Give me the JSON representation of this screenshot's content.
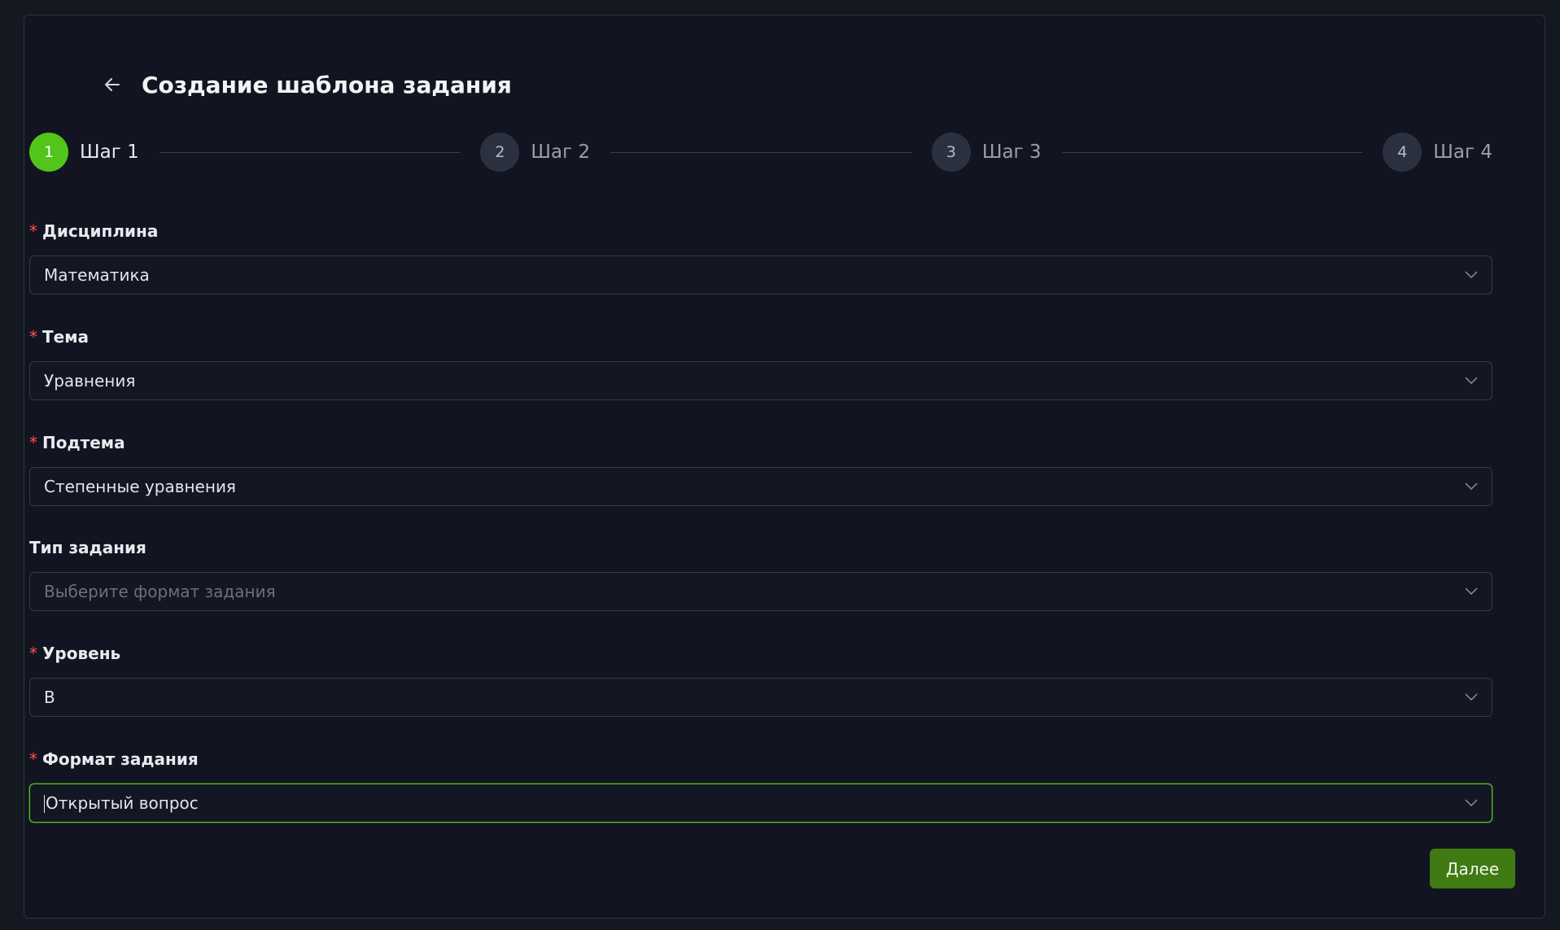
{
  "header": {
    "title": "Создание шаблона задания",
    "back_icon": "arrow-left-icon"
  },
  "steps": [
    {
      "number": "1",
      "label": "Шаг 1",
      "active": true
    },
    {
      "number": "2",
      "label": "Шаг 2",
      "active": false
    },
    {
      "number": "3",
      "label": "Шаг 3",
      "active": false
    },
    {
      "number": "4",
      "label": "Шаг 4",
      "active": false
    }
  ],
  "form": {
    "discipline": {
      "label": "Дисциплина",
      "required": true,
      "value": "Математика"
    },
    "topic": {
      "label": "Тема",
      "required": true,
      "value": "Уравнения"
    },
    "subtopic": {
      "label": "Подтема",
      "required": true,
      "value": "Степенные уравнения"
    },
    "task_type": {
      "label": "Тип задания",
      "required": false,
      "value": "",
      "placeholder": "Выберите формат задания"
    },
    "level": {
      "label": "Уровень",
      "required": true,
      "value": "B"
    },
    "task_format": {
      "label": "Формат задания",
      "required": true,
      "value": "Открытый вопрос"
    }
  },
  "required_mark": "*",
  "actions": {
    "next_label": "Далее"
  },
  "colors": {
    "accent": "#52c41a",
    "button": "#3f7a12",
    "required": "#ff4d4f"
  }
}
